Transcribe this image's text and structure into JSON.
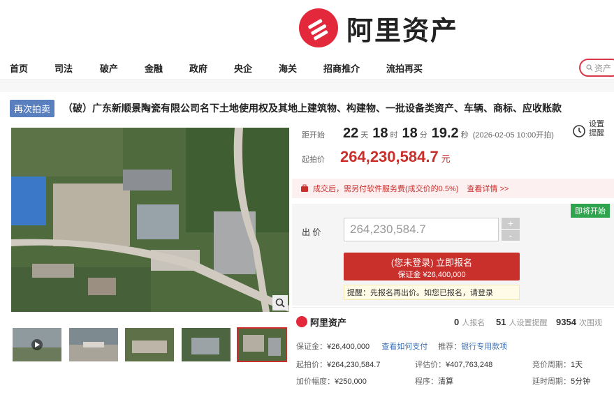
{
  "brand": {
    "name": "阿里资产",
    "color": "#e2283a"
  },
  "nav": {
    "items": [
      "首页",
      "司法",
      "破产",
      "金融",
      "政府",
      "央企",
      "海关",
      "招商推介",
      "流拍再买"
    ],
    "search_placeholder": "资产"
  },
  "auction": {
    "badge": "再次拍卖",
    "title": "（破）广东新顺景陶瓷有限公司名下土地使用权及其地上建筑物、构建物、一批设备类资产、车辆、商标、应收账款",
    "countdown_label": "距开始",
    "days": "22",
    "days_unit": "天",
    "hours": "18",
    "hours_unit": "时",
    "minutes": "18",
    "minutes_unit": "分",
    "seconds": "19.2",
    "seconds_unit": "秒",
    "start_time": "(2026-02-05 10:00开拍)",
    "remind_label": "设置提醒",
    "start_price_label": "起拍价",
    "start_price": "264,230,584.7",
    "start_price_unit": "元",
    "fee_notice": "成交后，需另付软件服务费(成交价的0.5%)",
    "fee_link": "查看详情 >>",
    "status_tag": "即将开始",
    "bid_label": "出  价",
    "bid_value": "264,230,584.7",
    "step_plus": "+",
    "step_minus": "-",
    "signup_line1": "(您未登录) 立即报名",
    "signup_line2": "保证金 ¥26,400,000",
    "tip": "提醒：先报名再出价。如您已报名，请登录"
  },
  "stats": {
    "brand": "阿里资产",
    "signed_num": "0",
    "signed_label": "人报名",
    "remind_num": "51",
    "remind_label": "人设置提醒",
    "view_num": "9354",
    "view_label": "次围观"
  },
  "info": {
    "deposit_label": "保证金：",
    "deposit": "¥26,400,000",
    "deposit_link": "查看如何支付",
    "recommend_label": "推荐：",
    "recommend_link": "银行专用款项",
    "start_label": "起拍价：",
    "start": "¥264,230,584.7",
    "assess_label": "评估价：",
    "assess": "¥407,763,248",
    "cycle_label": "竞价周期：",
    "cycle": "1天",
    "increment_label": "加价幅度：",
    "increment": "¥250,000",
    "procedure_label": "程序：",
    "procedure": "清算",
    "delay_label": "延时周期：",
    "delay": "5分钟"
  }
}
